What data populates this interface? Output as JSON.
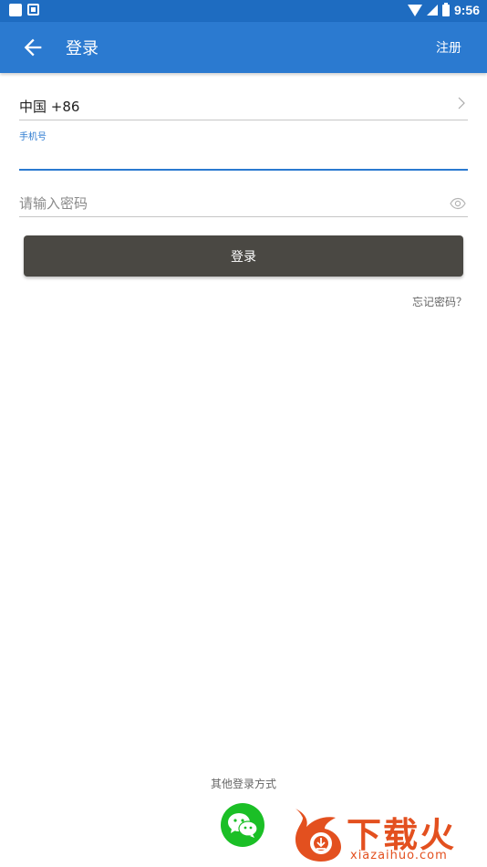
{
  "status_bar": {
    "time": "9:56"
  },
  "app_bar": {
    "title": "登录",
    "register_label": "注册"
  },
  "form": {
    "country": "中国 +86",
    "phone_label": "手机号",
    "phone_value": "",
    "password_placeholder": "请输入密码",
    "login_label": "登录",
    "forgot_label": "忘记密码？"
  },
  "other_login": {
    "label": "其他登录方式"
  },
  "watermark": {
    "text": "下载火",
    "url": "xiazaihuo.com"
  },
  "colors": {
    "primary": "#2b7ad0",
    "status_bar": "#1e6cc1",
    "button": "#4a4843",
    "wechat": "#1bbf26",
    "watermark": "#e3501f"
  }
}
